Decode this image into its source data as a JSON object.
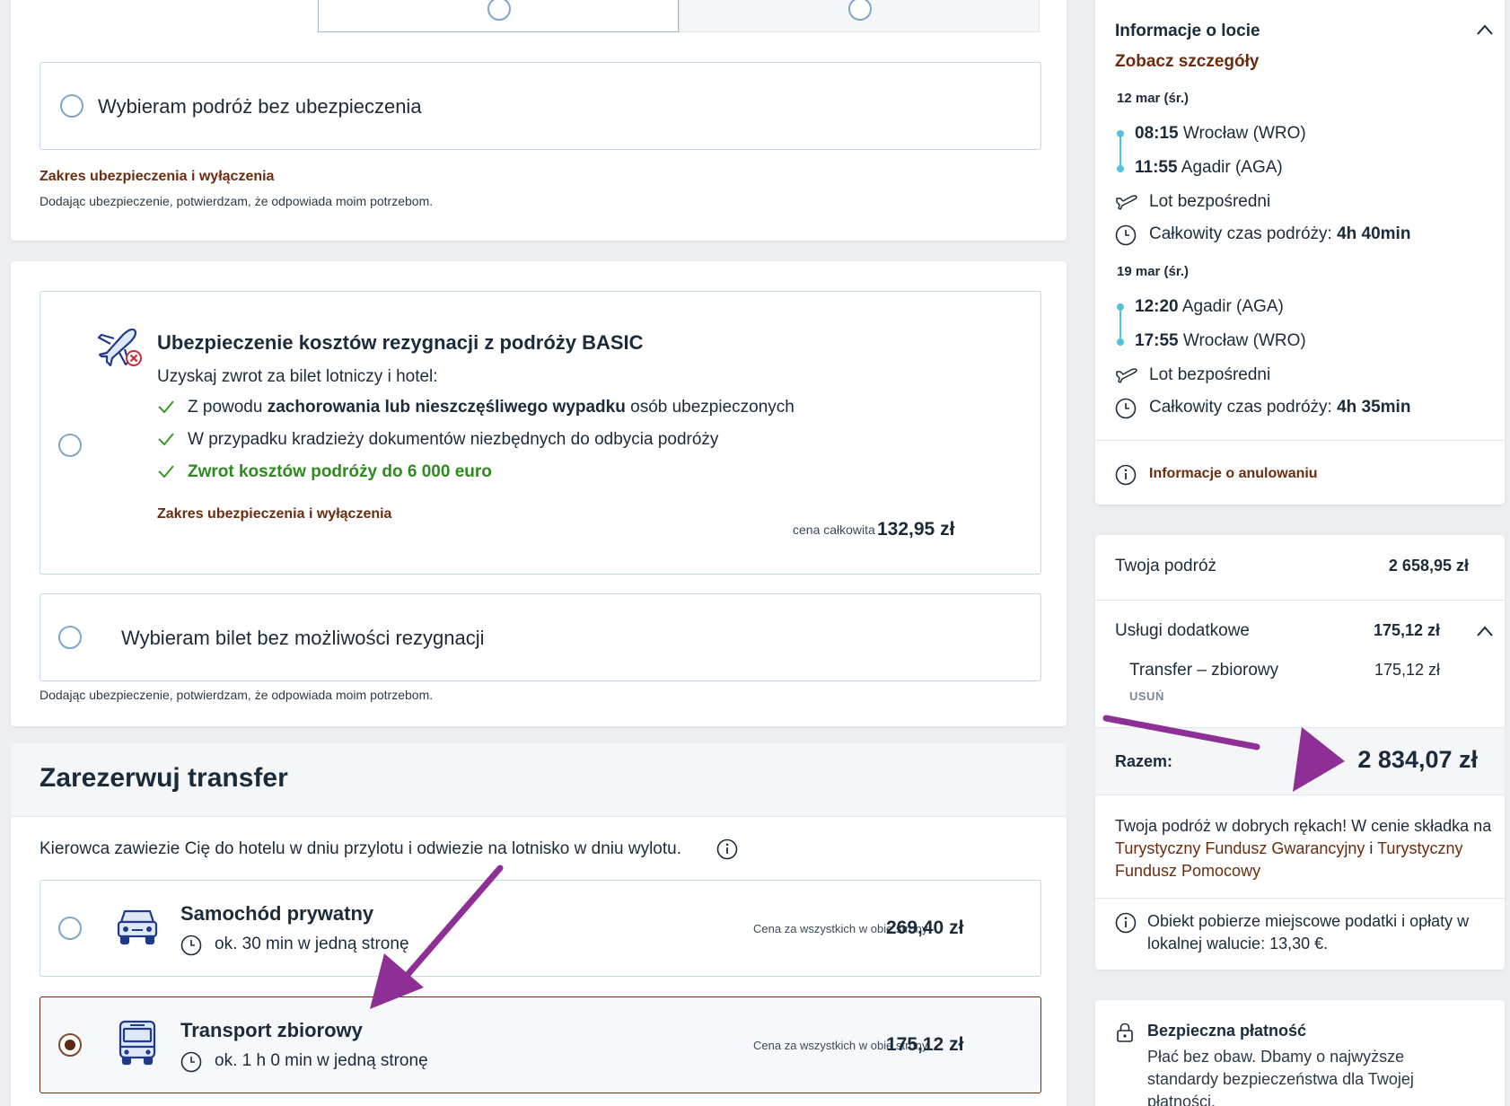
{
  "insurance_top": {
    "option_no_insurance": "Wybieram podróż bez ubezpieczenia",
    "scope_link": "Zakres ubezpieczenia i wyłączenia",
    "consent_note": "Dodając ubezpieczenie, potwierdzam, że odpowiada moim potrzebom."
  },
  "cancellation": {
    "title": "Ubezpieczenie kosztów rezygnacji z podróży BASIC",
    "intro": "Uzyskaj zwrot za bilet lotniczy i hotel:",
    "benefit1_pre": "Z powodu ",
    "benefit1_bold": "zachorowania lub nieszczęśliwego wypadku",
    "benefit1_post": " osób ubezpieczonych",
    "benefit2": "W przypadku kradzieży dokumentów niezbędnych do odbycia podróży",
    "benefit3": "Zwrot kosztów podróży do 6 000 euro",
    "scope_link": "Zakres ubezpieczenia i wyłączenia",
    "price_label": "cena całkowita",
    "price": "132,95 zł",
    "option_no_cancel": "Wybieram bilet bez możliwości rezygnacji",
    "consent_note": "Dodając ubezpieczenie, potwierdzam, że odpowiada moim potrzebom."
  },
  "transfer": {
    "heading": "Zarezerwuj transfer",
    "description": "Kierowca zawiezie Cię do hotelu w dniu przylotu i odwiezie na lotnisko w dniu wylotu.",
    "options": [
      {
        "name": "Samochód prywatny",
        "duration": "ok. 30 min w jedną stronę",
        "price_label": "Cena za wszystkich w obie strony",
        "price": "269,40 zł"
      },
      {
        "name": "Transport zbiorowy",
        "duration": "ok. 1 h 0 min w jedną stronę",
        "price_label": "Cena za wszystkich w obie strony",
        "price": "175,12 zł"
      }
    ]
  },
  "flight_info": {
    "title": "Informacje o locie",
    "details_link": "Zobacz szczegóły",
    "outbound": {
      "date": "12 mar (śr.)",
      "dep_time": "08:15",
      "dep_place": "Wrocław (WRO)",
      "arr_time": "11:55",
      "arr_place": "Agadir (AGA)",
      "type": "Lot bezpośredni",
      "duration_label": "Całkowity czas podróży:",
      "duration": "4h 40min"
    },
    "return": {
      "date": "19 mar (śr.)",
      "dep_time": "12:20",
      "dep_place": "Agadir (AGA)",
      "arr_time": "17:55",
      "arr_place": "Wrocław (WRO)",
      "type": "Lot bezpośredni",
      "duration_label": "Całkowity czas podróży:",
      "duration": "4h 35min"
    },
    "cancellation_info": "Informacje o anulowaniu"
  },
  "summary": {
    "trip_label": "Twoja podróż",
    "trip_price": "2 658,95 zł",
    "extras_label": "Usługi dodatkowe",
    "extras_price": "175,12 zł",
    "extra_item": "Transfer – zbiorowy",
    "extra_item_price": "175,12 zł",
    "remove": "USUŃ",
    "total_label": "Razem:",
    "total": "2 834,07 zł",
    "guarantee_pre": "Twoja podróż w dobrych rękach! W cenie składka na ",
    "guarantee_link1": "Turystyczny Fundusz Gwarancyjny",
    "guarantee_mid": " i ",
    "guarantee_link2": "Turystyczny Fundusz Pomocowy",
    "tax_note": "Obiekt pobierze miejscowe podatki i opłaty w lokalnej walucie: 13,30 €."
  },
  "secure": {
    "title": "Bezpieczna płatność",
    "text": "Płać bez obaw. Dbamy o najwyższe standardy bezpieczeństwa dla Twojej płatności."
  },
  "colors": {
    "brand_brown": "#6b2d0f",
    "green": "#2e8b1e",
    "annotation_purple": "#8e2f96",
    "timeline_dot": "#4fc3d8"
  }
}
